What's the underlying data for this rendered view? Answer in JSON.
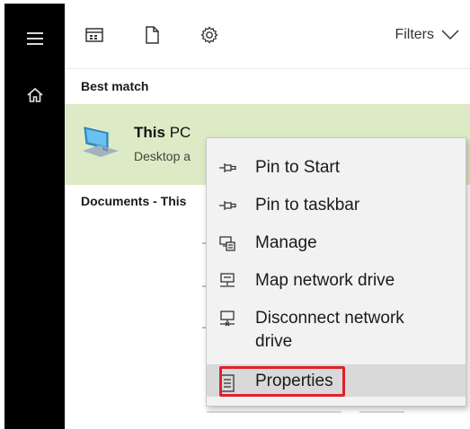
{
  "topbar": {
    "filters_label": "Filters"
  },
  "sections": {
    "best_match": "Best match",
    "documents": "Documents - This"
  },
  "best_match": {
    "title_bold": "This",
    "title_rest": "PC",
    "subtitle": "Desktop a"
  },
  "context_menu": {
    "items": [
      {
        "label": "Pin to Start",
        "icon": "pin-icon"
      },
      {
        "label": "Pin to taskbar",
        "icon": "pin-icon"
      },
      {
        "label": "Manage",
        "icon": "manage-icon"
      },
      {
        "label": "Map network drive",
        "icon": "map-network-drive-icon"
      },
      {
        "label": "Disconnect network drive",
        "icon": "disconnect-network-drive-icon"
      },
      {
        "label": "Properties",
        "icon": "properties-icon"
      }
    ],
    "highlighted_item": "Properties"
  },
  "colors": {
    "sidebar": "#000000",
    "best_match_bg": "#dcebc5",
    "menu_bg": "#f2f2f2",
    "highlight_border": "#e0202a"
  }
}
